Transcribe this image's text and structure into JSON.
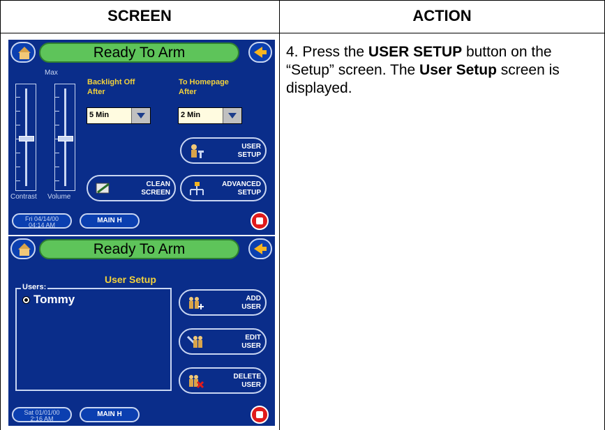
{
  "table": {
    "col_screen": "SCREEN",
    "col_action": "ACTION"
  },
  "action": {
    "num": "4.",
    "t1": " Press the ",
    "b1": "USER SETUP",
    "t2": " button on the “Setup” screen. The ",
    "b2": "User Setup",
    "t3": " screen is displayed."
  },
  "screen1": {
    "status": "Ready To Arm",
    "max_label": "Max",
    "backlight_label1": "Backlight Off",
    "backlight_label2": "After",
    "backlight_value": "5 Min",
    "home_label1": "To Homepage",
    "home_label2": "After",
    "home_value": "2 Min",
    "user_setup_l1": "USER",
    "user_setup_l2": "SETUP",
    "clean_l1": "CLEAN",
    "clean_l2": "SCREEN",
    "adv_l1": "ADVANCED",
    "adv_l2": "SETUP",
    "contrast_label": "Contrast",
    "volume_label": "Volume",
    "date": "Fri 04/14/00",
    "time": "04:14 AM",
    "main": "MAIN H"
  },
  "screen2": {
    "status": "Ready To Arm",
    "title": "User Setup",
    "users_legend": "Users:",
    "users": [
      "Tommy"
    ],
    "add_l1": "ADD",
    "add_l2": "USER",
    "edit_l1": "EDIT",
    "edit_l2": "USER",
    "del_l1": "DELETE",
    "del_l2": "USER",
    "date": "Sat 01/01/00",
    "time": "2:16 AM",
    "main": "MAIN H"
  },
  "colors": {
    "panel_bg": "#0a2d8a",
    "status_green": "#5ec45a",
    "label_yellow": "#f3d23b",
    "panic_red": "#e01b1b"
  }
}
